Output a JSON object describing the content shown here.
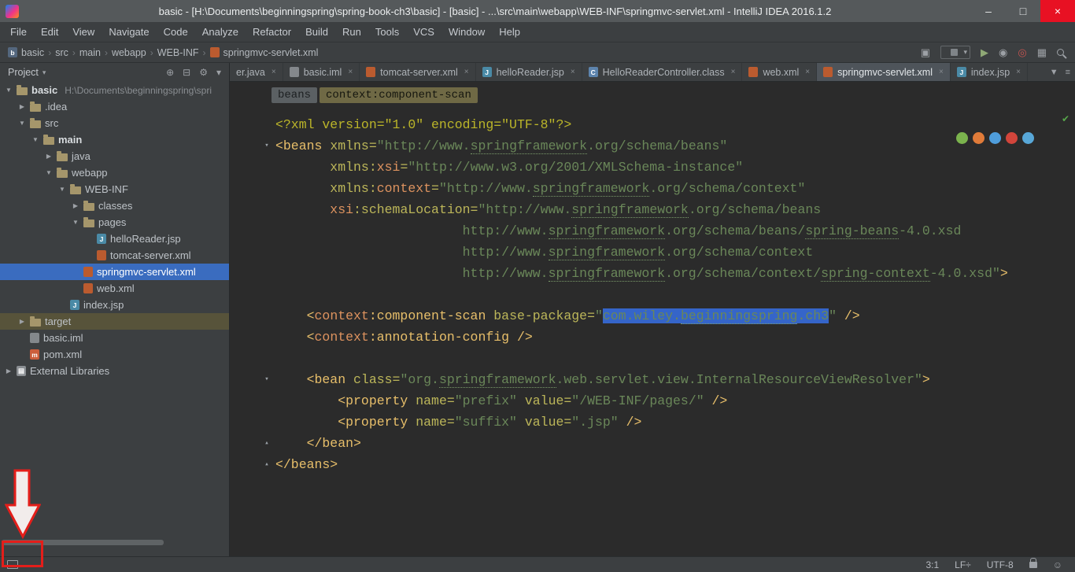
{
  "window": {
    "title": "basic - [H:\\Documents\\beginningspring\\spring-book-ch3\\basic] - [basic] - ...\\src\\main\\webapp\\WEB-INF\\springmvc-servlet.xml - IntelliJ IDEA 2016.1.2",
    "controls": [
      {
        "name": "minimize-button",
        "glyph": "–",
        "bg": ""
      },
      {
        "name": "maximize-button",
        "glyph": "□",
        "bg": ""
      },
      {
        "name": "close-button",
        "glyph": "×",
        "bg": "#e81123"
      }
    ]
  },
  "menu": {
    "items": [
      "File",
      "Edit",
      "View",
      "Navigate",
      "Code",
      "Analyze",
      "Refactor",
      "Build",
      "Run",
      "Tools",
      "VCS",
      "Window",
      "Help"
    ]
  },
  "navbar": {
    "separator": "›",
    "crumbs": [
      {
        "label": "basic",
        "icon": "project"
      },
      {
        "label": "src"
      },
      {
        "label": "main"
      },
      {
        "label": "webapp"
      },
      {
        "label": "WEB-INF"
      },
      {
        "label": "springmvc-servlet.xml",
        "icon": "xml"
      }
    ],
    "actions": [
      {
        "name": "changes-icon",
        "glyph": "▣",
        "color": "#9da1a6"
      },
      {
        "name": "run-configuration-select",
        "type": "combo",
        "glyph": "▾"
      },
      {
        "name": "run-icon",
        "glyph": "▶",
        "color": "#8fa876"
      },
      {
        "name": "debug-icon",
        "glyph": "◉",
        "color": "#9da1a6"
      },
      {
        "name": "coverage-icon",
        "glyph": "◎",
        "color": "#c75450"
      },
      {
        "name": "layout-icon",
        "glyph": "▦",
        "color": "#9da1a6"
      },
      {
        "name": "search-icon",
        "type": "magnifier"
      }
    ]
  },
  "icons": {
    "project": {
      "bg": "#54677e",
      "ch": "b"
    },
    "xml": {
      "bg": "#bb5b2f",
      "ch": ""
    },
    "jsp": {
      "bg": "#4a8aa6",
      "ch": "J"
    },
    "class": {
      "bg": "#5d84ad",
      "ch": "C"
    },
    "iml": {
      "bg": "#84888c",
      "ch": ""
    },
    "maven": {
      "bg": "#cb5e3c",
      "ch": "m"
    },
    "lib": {
      "bg": "#8a8e92",
      "ch": "▤"
    }
  },
  "tabs": {
    "close_glyph": "×",
    "extras": [
      {
        "name": "tab-list-dropdown-icon",
        "glyph": "▼"
      },
      {
        "name": "editor-menu-icon",
        "glyph": "≡"
      }
    ],
    "items": [
      {
        "label": "er.java"
      },
      {
        "label": "basic.iml",
        "icon": "iml"
      },
      {
        "label": "tomcat-server.xml",
        "icon": "xml"
      },
      {
        "label": "helloReader.jsp",
        "icon": "jsp"
      },
      {
        "label": "HelloReaderController.class",
        "icon": "class"
      },
      {
        "label": "web.xml",
        "icon": "xml"
      },
      {
        "label": "springmvc-servlet.xml",
        "icon": "xml",
        "active": true
      },
      {
        "label": "index.jsp",
        "icon": "jsp"
      }
    ]
  },
  "project": {
    "header": {
      "title": "Project",
      "caret": "▾",
      "actions": [
        {
          "name": "locate-icon",
          "glyph": "⊕"
        },
        {
          "name": "collapse-all-icon",
          "glyph": "⊟"
        },
        {
          "name": "settings-gear-icon",
          "glyph": "⚙"
        },
        {
          "name": "gear-dropdown-icon",
          "glyph": "▾"
        }
      ]
    },
    "tree": [
      {
        "d": 0,
        "label": "basic",
        "suffix": "H:\\Documents\\beginningspring\\spri",
        "icon": "folder",
        "arrow": "down",
        "bold": true
      },
      {
        "d": 1,
        "label": ".idea",
        "icon": "folder",
        "arrow": "right"
      },
      {
        "d": 1,
        "label": "src",
        "icon": "folder",
        "arrow": "down"
      },
      {
        "d": 2,
        "label": "main",
        "icon": "folder",
        "arrow": "down",
        "bold": true
      },
      {
        "d": 3,
        "label": "java",
        "icon": "folder",
        "arrow": "right"
      },
      {
        "d": 3,
        "label": "webapp",
        "icon": "folder",
        "arrow": "down"
      },
      {
        "d": 4,
        "label": "WEB-INF",
        "icon": "folder",
        "arrow": "down"
      },
      {
        "d": 5,
        "label": "classes",
        "icon": "folder",
        "arrow": "right"
      },
      {
        "d": 5,
        "label": "pages",
        "icon": "folder",
        "arrow": "down"
      },
      {
        "d": 6,
        "label": "helloReader.jsp",
        "icon": "jsp"
      },
      {
        "d": 6,
        "label": "tomcat-server.xml",
        "icon": "xml"
      },
      {
        "d": 5,
        "label": "springmvc-servlet.xml",
        "icon": "xml",
        "selected": true
      },
      {
        "d": 5,
        "label": "web.xml",
        "icon": "xml"
      },
      {
        "d": 4,
        "label": "index.jsp",
        "icon": "jsp"
      },
      {
        "d": 1,
        "label": "target",
        "icon": "folder",
        "arrow": "right",
        "highlight": true
      },
      {
        "d": 1,
        "label": "basic.iml",
        "icon": "iml"
      },
      {
        "d": 1,
        "label": "pom.xml",
        "icon": "maven"
      },
      {
        "d": 0,
        "label": "External Libraries",
        "icon": "lib",
        "arrow": "right"
      }
    ]
  },
  "editor": {
    "breadcrumbs": [
      {
        "label": "beans",
        "current": false
      },
      {
        "label": "context:component-scan",
        "current": true
      }
    ],
    "fold_glyphs": {
      "down": "▾",
      "up": "▴"
    },
    "inspection_ok_glyph": "✔",
    "browser_icons": [
      {
        "name": "chrome-icon",
        "color": "#7bb34d"
      },
      {
        "name": "firefox-icon",
        "color": "#e07b39"
      },
      {
        "name": "safari-icon",
        "color": "#4f9ddb"
      },
      {
        "name": "opera-icon",
        "color": "#d2453b"
      },
      {
        "name": "ie-icon",
        "color": "#58a7d7"
      }
    ],
    "lines": [
      {
        "tk": [
          [
            "pi",
            "<?xml version=\"1.0\" encoding=\"UTF-8\"?>"
          ]
        ]
      },
      {
        "fold": "down",
        "tk": [
          [
            "tag",
            "<beans "
          ],
          [
            "attr",
            "xmlns="
          ],
          [
            "str",
            "\"http://www."
          ],
          [
            "stru",
            "springframework"
          ],
          [
            "str",
            ".org/schema/beans\""
          ]
        ]
      },
      {
        "tk": [
          [
            "attr",
            "       xmlns:"
          ],
          [
            "ns",
            "xsi"
          ],
          [
            "attr",
            "="
          ],
          [
            "str",
            "\"http://www.w3.org/2001/XMLSchema-instance\""
          ]
        ]
      },
      {
        "tk": [
          [
            "attr",
            "       xmlns:"
          ],
          [
            "ns",
            "context"
          ],
          [
            "attr",
            "="
          ],
          [
            "str",
            "\"http://www."
          ],
          [
            "stru",
            "springframework"
          ],
          [
            "str",
            ".org/schema/context\""
          ]
        ]
      },
      {
        "tk": [
          [
            "ns",
            "       xsi"
          ],
          [
            "attr",
            ":schemaLocation="
          ],
          [
            "str",
            "\"http://www."
          ],
          [
            "stru",
            "springframework"
          ],
          [
            "str",
            ".org/schema/beans"
          ]
        ]
      },
      {
        "tk": [
          [
            "str",
            "                        http://www."
          ],
          [
            "stru",
            "springframework"
          ],
          [
            "str",
            ".org/schema/beans/"
          ],
          [
            "stru",
            "spring-beans"
          ],
          [
            "str",
            "-4.0.xsd"
          ]
        ]
      },
      {
        "tk": [
          [
            "str",
            "                        http://www."
          ],
          [
            "stru",
            "springframework"
          ],
          [
            "str",
            ".org/schema/context"
          ]
        ]
      },
      {
        "tk": [
          [
            "str",
            "                        http://www."
          ],
          [
            "stru",
            "springframework"
          ],
          [
            "str",
            ".org/schema/context/"
          ],
          [
            "stru",
            "spring-context"
          ],
          [
            "str",
            "-4.0.xsd\""
          ],
          [
            "tag",
            ">"
          ]
        ]
      },
      {
        "tk": []
      },
      {
        "tk": [
          [
            "tag",
            "    <"
          ],
          [
            "ns",
            "context"
          ],
          [
            "tag",
            ":component-scan "
          ],
          [
            "attr",
            "base-package="
          ],
          [
            "str",
            "\""
          ],
          [
            "str sel",
            "com.wiley."
          ],
          [
            "stru sel",
            "beginningspring"
          ],
          [
            "str sel",
            ".ch3"
          ],
          [
            "str",
            "\" "
          ],
          [
            "tag",
            "/>"
          ]
        ]
      },
      {
        "tk": [
          [
            "tag",
            "    <"
          ],
          [
            "ns",
            "context"
          ],
          [
            "tag",
            ":annotation-config "
          ],
          [
            "tag",
            "/>"
          ]
        ]
      },
      {
        "tk": []
      },
      {
        "fold": "down",
        "tk": [
          [
            "tag",
            "    <bean "
          ],
          [
            "attr",
            "class="
          ],
          [
            "str",
            "\"org."
          ],
          [
            "stru",
            "springframework"
          ],
          [
            "str",
            ".web.servlet.view.InternalResourceViewResolver\""
          ],
          [
            "tag",
            ">"
          ]
        ]
      },
      {
        "tk": [
          [
            "tag",
            "        <property "
          ],
          [
            "attr",
            "name="
          ],
          [
            "str",
            "\"prefix\" "
          ],
          [
            "attr",
            "value="
          ],
          [
            "str",
            "\"/WEB-INF/pages/\" "
          ],
          [
            "tag",
            "/>"
          ]
        ]
      },
      {
        "tk": [
          [
            "tag",
            "        <property "
          ],
          [
            "attr",
            "name="
          ],
          [
            "str",
            "\"suffix\" "
          ],
          [
            "attr",
            "value="
          ],
          [
            "str",
            "\".jsp\" "
          ],
          [
            "tag",
            "/>"
          ]
        ]
      },
      {
        "fold": "up",
        "tk": [
          [
            "tag",
            "    </bean>"
          ]
        ]
      },
      {
        "fold": "up",
        "tk": [
          [
            "tag",
            "</beans>"
          ]
        ]
      }
    ]
  },
  "status": {
    "right": [
      {
        "name": "caret-position",
        "text": "3:1"
      },
      {
        "name": "line-separator",
        "text": "LF÷"
      },
      {
        "name": "file-encoding",
        "text": "UTF-8"
      }
    ],
    "hector_glyph": "☺"
  },
  "annotations": {
    "color": "#e41e1a"
  }
}
